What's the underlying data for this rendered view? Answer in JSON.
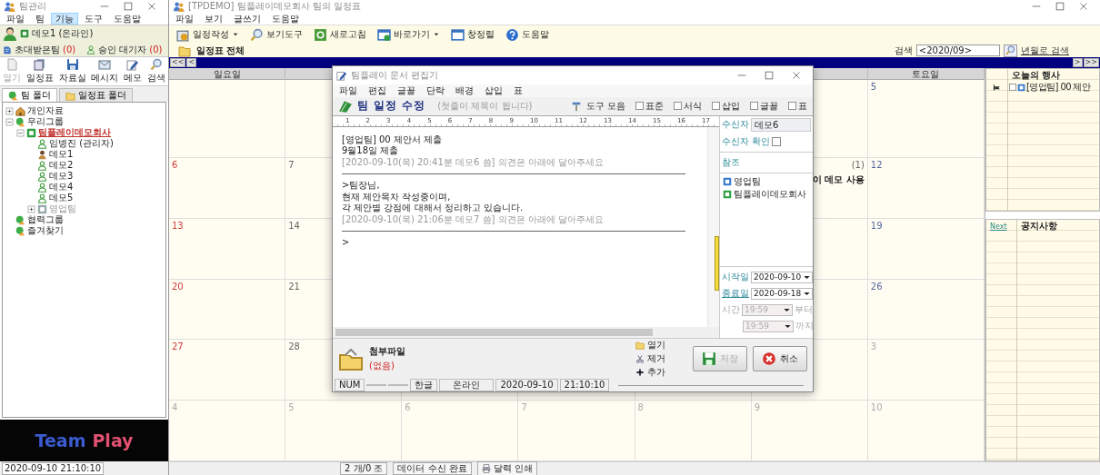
{
  "left_window": {
    "title": "팀관리",
    "menu": [
      {
        "label": "파일",
        "selected": false
      },
      {
        "label": "팀",
        "selected": false
      },
      {
        "label": "기능",
        "selected": true
      },
      {
        "label": "도구",
        "selected": false
      },
      {
        "label": "도움말",
        "selected": false
      }
    ],
    "user": {
      "name": "데모1 (온라인)",
      "invited_label": "초대받은팀",
      "invited_count": "(0)",
      "pending_label": "승인 대기자",
      "pending_count": "(0)"
    },
    "toolbar": [
      {
        "label": "열기",
        "kind": "open",
        "disabled": true
      },
      {
        "label": "일정표",
        "kind": "schedule",
        "disabled": false
      },
      {
        "label": "자료실",
        "kind": "files",
        "disabled": false
      },
      {
        "label": "메시지",
        "kind": "message",
        "disabled": false
      },
      {
        "label": "메모",
        "kind": "memo",
        "disabled": false
      },
      {
        "label": "검색",
        "kind": "search",
        "disabled": false
      }
    ],
    "folder_tabs": [
      {
        "label": "팀 폴더",
        "selected": true
      },
      {
        "label": "일정표 폴더",
        "selected": false
      }
    ],
    "tree": [
      {
        "label": "개인자료",
        "kind": "personal",
        "expanded": false,
        "selected": false,
        "disabled": false
      },
      {
        "label": "우리그룹",
        "kind": "group",
        "expanded": true,
        "selected": false,
        "disabled": false,
        "children": [
          {
            "label": "팀플레이데모회사",
            "kind": "team",
            "expanded": true,
            "selected": true,
            "disabled": false,
            "children": [
              {
                "label": "임병진 (관리자)",
                "kind": "member",
                "selected": false,
                "disabled": false
              },
              {
                "label": "데모1",
                "kind": "me",
                "selected": false,
                "disabled": false
              },
              {
                "label": "데모2",
                "kind": "member",
                "selected": false,
                "disabled": false
              },
              {
                "label": "데모3",
                "kind": "member",
                "selected": false,
                "disabled": false
              },
              {
                "label": "데모4",
                "kind": "member",
                "selected": false,
                "disabled": false
              },
              {
                "label": "데모5",
                "kind": "member",
                "selected": false,
                "disabled": false
              },
              {
                "label": "영업팀",
                "kind": "team",
                "expanded": false,
                "selected": false,
                "disabled": true
              }
            ]
          }
        ]
      },
      {
        "label": "협력그룹",
        "kind": "group",
        "selected": false,
        "disabled": false
      },
      {
        "label": "즐겨찾기",
        "kind": "group",
        "selected": false,
        "disabled": false
      }
    ],
    "logo": {
      "first": "Team",
      "second": "Play"
    },
    "status": "2020-09-10 21:10:10"
  },
  "main_window": {
    "title": "[TPDEMO] 팀플레이데모회사 팀의 일정표",
    "menu": [
      "파일",
      "보기",
      "글쓰기",
      "도움말"
    ],
    "toolbar": [
      {
        "label": "일정작성",
        "kind": "new_schedule",
        "dropdown": true
      },
      {
        "label": "보기도구",
        "kind": "view",
        "dropdown": false
      },
      {
        "label": "새로고침",
        "kind": "refresh",
        "dropdown": false
      },
      {
        "label": "바로가기",
        "kind": "shortcut",
        "dropdown": true
      },
      {
        "label": "창정렬",
        "kind": "arrange",
        "dropdown": false
      },
      {
        "label": "도움말",
        "kind": "help",
        "dropdown": false
      }
    ],
    "view_title": "일정표 전체",
    "search": {
      "label": "검색",
      "value": "<2020/09>",
      "link": "년월로 검색"
    },
    "nav_prev": [
      "<<",
      "<"
    ],
    "nav_next": [
      ">",
      ">>"
    ],
    "calendar": {
      "headers": {
        "sun": "일요일",
        "sat": "토요일"
      },
      "weeks": [
        {
          "sat": {
            "date": "5",
            "other_month": false
          }
        },
        {
          "sun": {
            "date": "6",
            "other_month": false
          },
          "mon": {
            "date": "7",
            "other_month": false
          },
          "fri": {
            "event": "이 데모 사용",
            "count": "(1)"
          },
          "sat": {
            "date": "12",
            "other_month": false
          }
        },
        {
          "sun": {
            "date": "13",
            "other_month": false
          },
          "mon": {
            "date": "14",
            "other_month": false
          },
          "sat": {
            "date": "19",
            "other_month": false
          }
        },
        {
          "sun": {
            "date": "20",
            "other_month": false
          },
          "mon": {
            "date": "21",
            "other_month": false
          },
          "sat": {
            "date": "26",
            "other_month": false
          }
        },
        {
          "sun": {
            "date": "27",
            "other_month": false
          },
          "mon": {
            "date": "28",
            "other_month": false
          },
          "sat": {
            "date": "3",
            "other_month": true
          }
        },
        {
          "sun": {
            "date": "4",
            "other_month": true
          },
          "mon": {
            "date": "5",
            "other_month": true
          },
          "tue": {
            "date": "6",
            "other_month": true
          },
          "wed": {
            "date": "7",
            "other_month": true
          },
          "thu": {
            "date": "8",
            "other_month": true
          },
          "fri": {
            "date": "9",
            "other_month": true
          },
          "sat": {
            "date": "10",
            "other_month": true
          }
        }
      ]
    },
    "today": {
      "title": "오늘의 행사",
      "items": [
        {
          "text": "[영업팀] 00 제안",
          "checked": false
        }
      ]
    },
    "notice": {
      "link": "Next",
      "title": "공지사항"
    },
    "status": [
      "2 개/0 조",
      "데이터 수신 완료",
      "달력 인쇄"
    ]
  },
  "editor": {
    "title": "팀플레이 문서 편집기",
    "menu": [
      "파일",
      "편집",
      "글꼴",
      "단락",
      "배경",
      "삽입",
      "표"
    ],
    "heading": "팀 일정 수정",
    "hint": "(첫줄이 제목이 됩니다)",
    "toolbar_label": "도구 모음",
    "toolbars": [
      {
        "label": "표준",
        "checked": false
      },
      {
        "label": "서식",
        "checked": false
      },
      {
        "label": "삽입",
        "checked": false
      },
      {
        "label": "글꼴",
        "checked": false
      },
      {
        "label": "표",
        "checked": false
      }
    ],
    "ruler": [
      "1",
      "2",
      "3",
      "4",
      "5",
      "6",
      "7",
      "8",
      "9",
      "10",
      "11",
      "12",
      "13",
      "14",
      "15",
      "16",
      "17"
    ],
    "lines": [
      {
        "kind": "body",
        "text": "[영업팀] 00 제안서 제출"
      },
      {
        "kind": "body",
        "text": "9월18일 제출"
      },
      {
        "kind": "meta",
        "text": "[2020-09-10(목) 20:41분 데모6 씀]  의견은 아래에 달아주세요"
      },
      {
        "kind": "rule"
      },
      {
        "kind": "body",
        "text": ">팀장님,"
      },
      {
        "kind": "body",
        "text": " 현재 제안목차 작성중이며,"
      },
      {
        "kind": "body",
        "text": " 각 제안별 강점에 대해서 정리하고 있습니다."
      },
      {
        "kind": "meta",
        "text": "[2020-09-10(목) 21:06분 데모7 씀]  의견은 아래에 달아주세요"
      },
      {
        "kind": "rule"
      },
      {
        "kind": "body",
        "text": ">"
      }
    ],
    "recipient_label": "수신자",
    "recipient": "데모6",
    "confirm_label": "수신자 확인",
    "confirm_checked": false,
    "cc_label": "참조",
    "cc": [
      {
        "label": "영업팀",
        "kind": "team_blue"
      },
      {
        "label": "팀플레이데모회사",
        "kind": "team_green"
      }
    ],
    "start": {
      "label": "시작일",
      "value": "2020-09-10"
    },
    "end": {
      "label": "종료일",
      "value": "2020-09-18"
    },
    "time": {
      "label": "시간",
      "from": "19:59",
      "from_suffix": "부터",
      "to": "19:59",
      "to_suffix": "까지",
      "disabled": true
    },
    "attachment": {
      "label": "첨부파일",
      "value": "(없음)"
    },
    "file_actions": [
      {
        "label": "열기",
        "kind": "open"
      },
      {
        "label": "제거",
        "kind": "remove"
      },
      {
        "label": "추가",
        "kind": "add"
      }
    ],
    "buttons": [
      {
        "label": "저장",
        "kind": "save",
        "disabled": true
      },
      {
        "label": "취소",
        "kind": "cancel",
        "disabled": false
      }
    ],
    "status": [
      "NUM",
      "한글",
      "온라인",
      "2020-09-10",
      "21:10:10"
    ]
  }
}
